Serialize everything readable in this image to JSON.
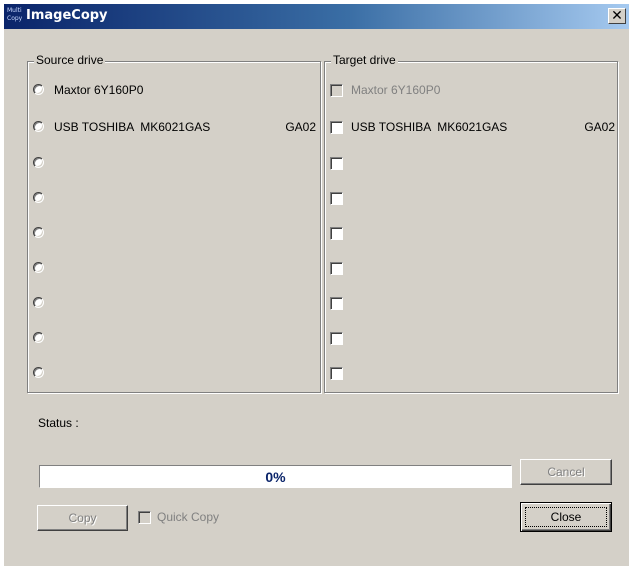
{
  "window": {
    "icon_text": "Multi Copy",
    "title": "ImageCopy",
    "close_glyph": "✕"
  },
  "source": {
    "legend": "Source drive",
    "drives": [
      {
        "label": "Maxtor 6Y160P0",
        "rev": ""
      },
      {
        "label": "USB TOSHIBA  MK6021GAS",
        "rev": "GA02"
      },
      {
        "label": "",
        "rev": ""
      },
      {
        "label": "",
        "rev": ""
      },
      {
        "label": "",
        "rev": ""
      },
      {
        "label": "",
        "rev": ""
      },
      {
        "label": "",
        "rev": ""
      },
      {
        "label": "",
        "rev": ""
      },
      {
        "label": "",
        "rev": ""
      }
    ]
  },
  "target": {
    "legend": "Target drive",
    "drives": [
      {
        "label": "Maxtor 6Y160P0",
        "rev": "",
        "disabled": true
      },
      {
        "label": "USB TOSHIBA  MK6021GAS",
        "rev": "GA02",
        "disabled": false
      },
      {
        "label": "",
        "rev": "",
        "disabled": false
      },
      {
        "label": "",
        "rev": "",
        "disabled": false
      },
      {
        "label": "",
        "rev": "",
        "disabled": false
      },
      {
        "label": "",
        "rev": "",
        "disabled": false
      },
      {
        "label": "",
        "rev": "",
        "disabled": false
      },
      {
        "label": "",
        "rev": "",
        "disabled": false
      },
      {
        "label": "",
        "rev": "",
        "disabled": false
      }
    ]
  },
  "status": {
    "label": "Status :",
    "progress_text": "0%",
    "progress_fraction": 0
  },
  "buttons": {
    "cancel": "Cancel",
    "copy": "Copy",
    "quick_copy": "Quick Copy",
    "close": "Close"
  },
  "colors": {
    "title_gradient_start": "#0a246a",
    "title_gradient_end": "#a6caf0",
    "face": "#d4d0c8",
    "progress_text": "#0a246a"
  }
}
